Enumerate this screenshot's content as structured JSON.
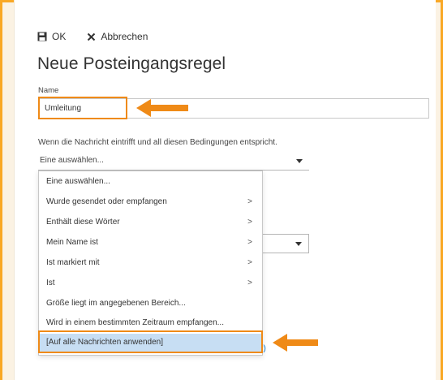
{
  "toolbar": {
    "ok_label": "OK",
    "cancel_label": "Abbrechen"
  },
  "page_title": "Neue Posteingangsregel",
  "name_field": {
    "label": "Name",
    "value": "Umleitung"
  },
  "condition": {
    "label": "Wenn die Nachricht eintrifft und all diesen Bedingungen entspricht.",
    "selected": "Eine auswählen..."
  },
  "dropdown_items": [
    {
      "label": "Eine auswählen...",
      "chevron": ""
    },
    {
      "label": "Wurde gesendet oder empfangen",
      "chevron": ">"
    },
    {
      "label": "Enthält diese Wörter",
      "chevron": ">"
    },
    {
      "label": "Mein Name ist",
      "chevron": ">"
    },
    {
      "label": "Ist markiert mit",
      "chevron": ">"
    },
    {
      "label": "Ist",
      "chevron": ">"
    },
    {
      "label": "Größe liegt im angegebenen Bereich...",
      "chevron": ""
    },
    {
      "label": "Wird in einem bestimmten Zeitraum empfangen...",
      "chevron": ""
    },
    {
      "label": "[Auf alle Nachrichten anwenden]",
      "chevron": ""
    }
  ],
  "background_link_fragment": "s?)",
  "colors": {
    "border_accent": "#F9A825",
    "highlight": "#EF8A17",
    "selected_item": "#C7DEF3",
    "link": "#0072C6"
  },
  "icons": {
    "ok": "save-icon",
    "cancel": "close-icon",
    "arrows": "arrow-left-icon"
  }
}
